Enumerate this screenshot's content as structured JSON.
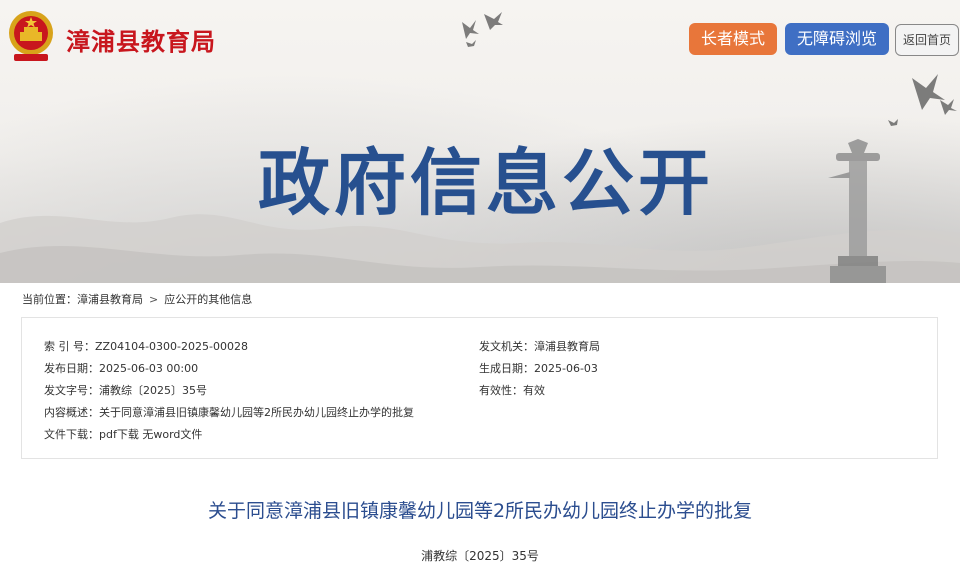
{
  "header": {
    "site_name": "漳浦县教育局",
    "elder_mode_label": "长者模式",
    "accessible_label": "无障碍浏览",
    "home_label": "返回首页",
    "banner_title": "政府信息公开"
  },
  "breadcrumb": {
    "prefix": "当前位置：",
    "items": [
      "漳浦县教育局",
      "应公开的其他信息"
    ],
    "separator": ">"
  },
  "info": {
    "index_label": "索 引 号：",
    "index_value": "ZZ04104-0300-2025-00028",
    "issuer_label": "发文机关：",
    "issuer_value": "漳浦县教育局",
    "publish_label": "发布日期：",
    "publish_value": "2025-06-03 00:00",
    "effective_date_label": "生成日期：",
    "effective_date_value": "2025-06-03",
    "doc_no_label": "发文字号：",
    "doc_no_value": "浦教综〔2025〕35号",
    "validity_label": "有效性：",
    "validity_value": "有效",
    "summary_label": "内容概述：",
    "summary_value": "关于同意漳浦县旧镇康馨幼儿园等2所民办幼儿园终止办学的批复",
    "download_label": "文件下载：",
    "download_pdf": "pdf下载",
    "download_word": "无word文件"
  },
  "article": {
    "title": "关于同意漳浦县旧镇康馨幼儿园等2所民办幼儿园终止办学的批复",
    "doc_number": "浦教综〔2025〕35号"
  },
  "colors": {
    "site_name": "#c8161d",
    "elder_button": "#e8763a",
    "accessible_button": "#3f6fc4",
    "banner_title": "#27508f",
    "article_title": "#2b4d8f"
  },
  "icons": [
    "national-emblem-icon",
    "bird-icon",
    "huabiao-pillar-icon"
  ]
}
